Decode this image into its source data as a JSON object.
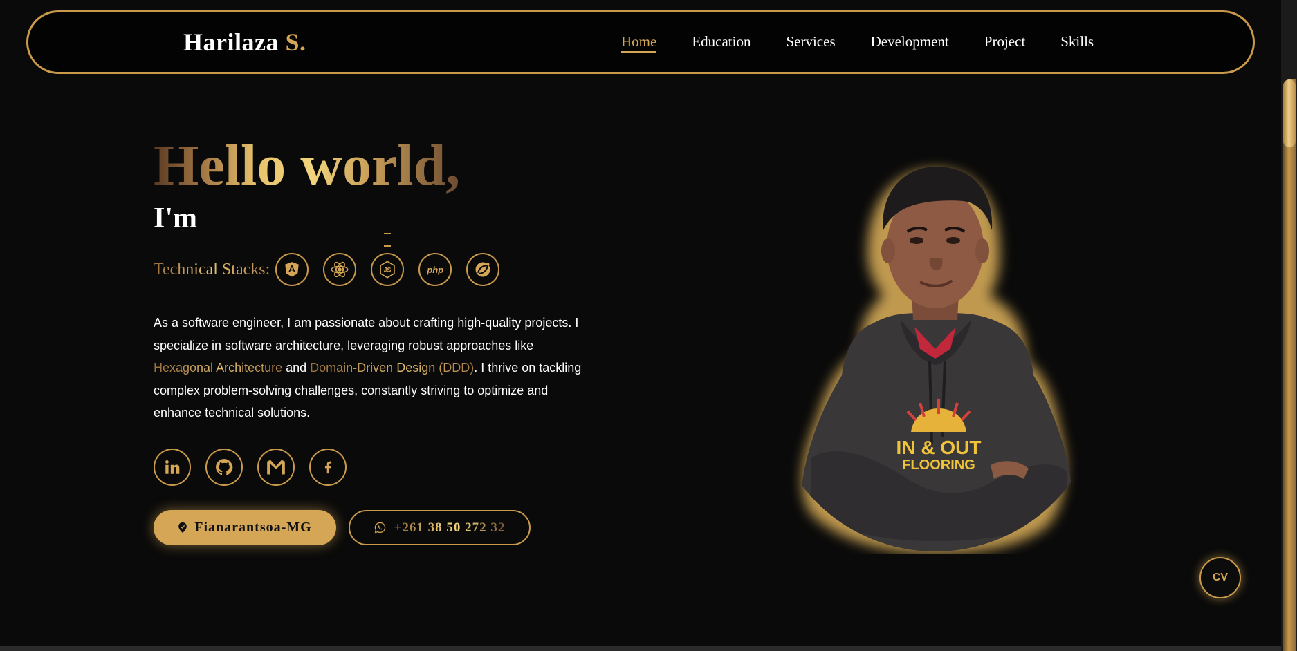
{
  "brand": {
    "name": "Harilaza",
    "accent": "S."
  },
  "nav": [
    {
      "label": "Home",
      "active": true
    },
    {
      "label": "Education",
      "active": false
    },
    {
      "label": "Services",
      "active": false
    },
    {
      "label": "Development",
      "active": false
    },
    {
      "label": "Project",
      "active": false
    },
    {
      "label": "Skills",
      "active": false
    }
  ],
  "hero": {
    "greeting": "Hello world,",
    "intro": "I'm",
    "stacks_label": "Technical Stacks:",
    "stacks": [
      "angular-icon",
      "react-icon",
      "nodejs-icon",
      "php-icon",
      "spring-icon"
    ],
    "php_text": "php",
    "about": {
      "part1": "As a software engineer, I am passionate about crafting high-quality projects. I specialize in software architecture, leveraging robust approaches like ",
      "highlight1": "Hexagonal Architecture",
      "part2": " and ",
      "highlight2": "Domain-Driven Design (DDD)",
      "part3": ". I thrive on tackling complex problem-solving challenges, constantly striving to optimize and enhance technical solutions."
    },
    "socials": [
      "linkedin-icon",
      "github-icon",
      "gmail-icon",
      "facebook-icon"
    ],
    "location": "Fianarantsoa-MG",
    "phone": "+261 38 50 272 32"
  },
  "portrait": {
    "shirt_text_line1": "IN & OUT",
    "shirt_text_line2": "FLOORING"
  },
  "cv_button": "CV",
  "colors": {
    "accent": "#d4a656",
    "border": "#c99a4a",
    "background": "#0a0a0a"
  }
}
